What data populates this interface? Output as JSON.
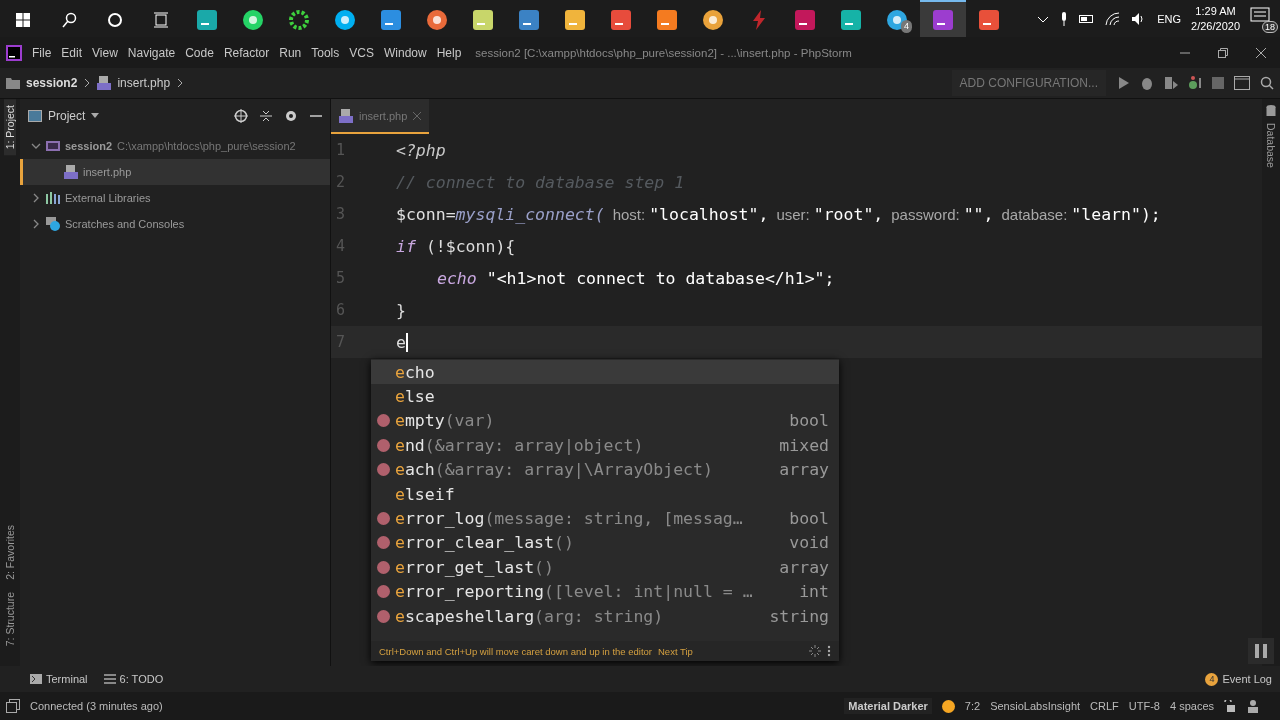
{
  "taskbar": {
    "apps": [
      {
        "kind": "start",
        "selected": false
      },
      {
        "kind": "search",
        "selected": false
      },
      {
        "kind": "cortana",
        "selected": false
      },
      {
        "kind": "taskview",
        "selected": false
      },
      {
        "kind": "tile",
        "color": "#1aa9a9",
        "selected": false
      },
      {
        "kind": "round",
        "color": "#25d366",
        "selected": false
      },
      {
        "kind": "ring",
        "color": "#3ecf3e",
        "selected": false
      },
      {
        "kind": "round",
        "color": "#00aff0",
        "selected": false
      },
      {
        "kind": "tile",
        "color": "#2c8ee0",
        "selected": false
      },
      {
        "kind": "round",
        "color": "#e96a3a",
        "selected": false
      },
      {
        "kind": "tile",
        "color": "#c8d66a",
        "selected": false
      },
      {
        "kind": "tile",
        "color": "#3b82c4",
        "selected": false
      },
      {
        "kind": "tile",
        "color": "#f0b43c",
        "selected": false
      },
      {
        "kind": "tile",
        "color": "#e74c3c",
        "selected": false
      },
      {
        "kind": "tile",
        "color": "#f47b20",
        "selected": false
      },
      {
        "kind": "round",
        "color": "#e9a23b",
        "selected": false
      },
      {
        "kind": "bolt",
        "color": "#c0262c",
        "selected": false
      },
      {
        "kind": "tile",
        "color": "#c2185b",
        "selected": false
      },
      {
        "kind": "tile",
        "color": "#16b3a7",
        "selected": false
      },
      {
        "kind": "round",
        "color": "#2ea6e0",
        "badge": "4",
        "selected": false
      },
      {
        "kind": "tile",
        "color": "#9c3dcf",
        "selected": true
      },
      {
        "kind": "tile",
        "color": "#e8503a",
        "selected": false
      }
    ],
    "language": "ENG",
    "time": "1:29 AM",
    "date": "2/26/2020",
    "notifications": "18"
  },
  "window": {
    "title": "session2 [C:\\xampp\\htdocs\\php_pure\\session2] - ...\\insert.php - PhpStorm"
  },
  "menu": [
    "File",
    "Edit",
    "View",
    "Navigate",
    "Code",
    "Refactor",
    "Run",
    "Tools",
    "VCS",
    "Window",
    "Help"
  ],
  "breadcrumb": [
    "session2",
    "insert.php"
  ],
  "run_configuration": "ADD CONFIGURATION...",
  "left_tool_tabs": [
    {
      "label": "1: Project",
      "selected": true
    },
    {
      "label": "2: Favorites",
      "selected": false
    },
    {
      "label": "7: Structure",
      "selected": false
    }
  ],
  "right_tool_tabs": [
    {
      "label": "Database",
      "selected": false
    }
  ],
  "project": {
    "title": "Project",
    "tree": [
      {
        "label": "session2",
        "path": "C:\\xampp\\htdocs\\php_pure\\session2",
        "kind": "folder",
        "expanded": true,
        "selected": false,
        "children": [
          {
            "label": "insert.php",
            "kind": "php",
            "selected": true
          }
        ]
      },
      {
        "label": "External Libraries",
        "kind": "libraries",
        "expanded": false,
        "selected": false
      },
      {
        "label": "Scratches and Consoles",
        "kind": "scratches",
        "expanded": false,
        "selected": false
      }
    ]
  },
  "editor": {
    "tabs": [
      {
        "label": "insert.php",
        "selected": true
      }
    ],
    "lines": [
      {
        "number": "1",
        "current": false,
        "tokens": [
          {
            "kind": "tag",
            "text": "<?php"
          }
        ]
      },
      {
        "number": "2",
        "current": false,
        "tokens": [
          {
            "kind": "comment",
            "text": "// connect to database step 1"
          }
        ]
      },
      {
        "number": "3",
        "current": false,
        "tokens": [
          {
            "kind": "variable",
            "text": "$conn="
          },
          {
            "kind": "function",
            "text": "mysqli_connect("
          },
          {
            "kind": "hint",
            "text": "host:"
          },
          {
            "kind": "string",
            "text": "\"localhost\","
          },
          {
            "kind": "hint",
            "text": "user:"
          },
          {
            "kind": "string",
            "text": "\"root\","
          },
          {
            "kind": "hint",
            "text": "password:"
          },
          {
            "kind": "string",
            "text": "\"\","
          },
          {
            "kind": "hint",
            "text": "database:"
          },
          {
            "kind": "string",
            "text": "\"learn\");"
          }
        ]
      },
      {
        "number": "4",
        "current": false,
        "tokens": [
          {
            "kind": "keyword",
            "text": "if"
          },
          {
            "kind": "plain",
            "text": "(!$conn){"
          }
        ],
        "children": [
          {
            "number": "5",
            "current": false,
            "tokens": [
              {
                "kind": "keyword",
                "text": "echo"
              },
              {
                "kind": "string",
                "text": "\"<h1>not connect to database</h1>\";"
              }
            ]
          }
        ]
      },
      {
        "number": "6",
        "current": false,
        "tokens": [
          {
            "kind": "plain",
            "text": "}"
          }
        ]
      },
      {
        "number": "7",
        "current": true,
        "tokens": [
          {
            "kind": "plain",
            "text": "e"
          }
        ]
      }
    ]
  },
  "completion": {
    "items": [
      {
        "kind": "keyword",
        "name": "echo",
        "selected": true
      },
      {
        "kind": "keyword",
        "name": "else",
        "selected": false
      },
      {
        "kind": "function",
        "name": "empty",
        "params": "(var)",
        "type": "bool",
        "selected": false
      },
      {
        "kind": "function",
        "name": "end",
        "params": "(&array: array|object)",
        "type": "mixed",
        "selected": false
      },
      {
        "kind": "function",
        "name": "each",
        "params": "(&array: array|\\ArrayObject)",
        "type": "array",
        "selected": false
      },
      {
        "kind": "keyword",
        "name": "elseif",
        "selected": false
      },
      {
        "kind": "function",
        "name": "error_log",
        "params": "(message: string, [messag…",
        "type": "bool",
        "selected": false
      },
      {
        "kind": "function",
        "name": "error_clear_last",
        "params": "()",
        "type": "void",
        "selected": false
      },
      {
        "kind": "function",
        "name": "error_get_last",
        "params": "()",
        "type": "array",
        "selected": false
      },
      {
        "kind": "function",
        "name": "error_reporting",
        "params": "([level: int|null = …",
        "type": "int",
        "selected": false
      },
      {
        "kind": "function",
        "name": "escapeshellarg",
        "params": "(arg: string)",
        "type": "string",
        "selected": false
      }
    ],
    "tip": "Ctrl+Down and Ctrl+Up will move caret down and up in the editor",
    "tip_link": "Next Tip"
  },
  "bottom_tool_tabs": [
    {
      "label": "Terminal",
      "kind": "terminal"
    },
    {
      "label": "6: TODO",
      "kind": "todo"
    }
  ],
  "event_log": {
    "label": "Event Log",
    "badge": "4"
  },
  "status_bar": {
    "message": "Connected (3 minutes ago)",
    "theme": "Material Darker",
    "items": [
      "7:2",
      "SensioLabsInsight",
      "CRLF",
      "UTF-8",
      "4 spaces"
    ]
  }
}
